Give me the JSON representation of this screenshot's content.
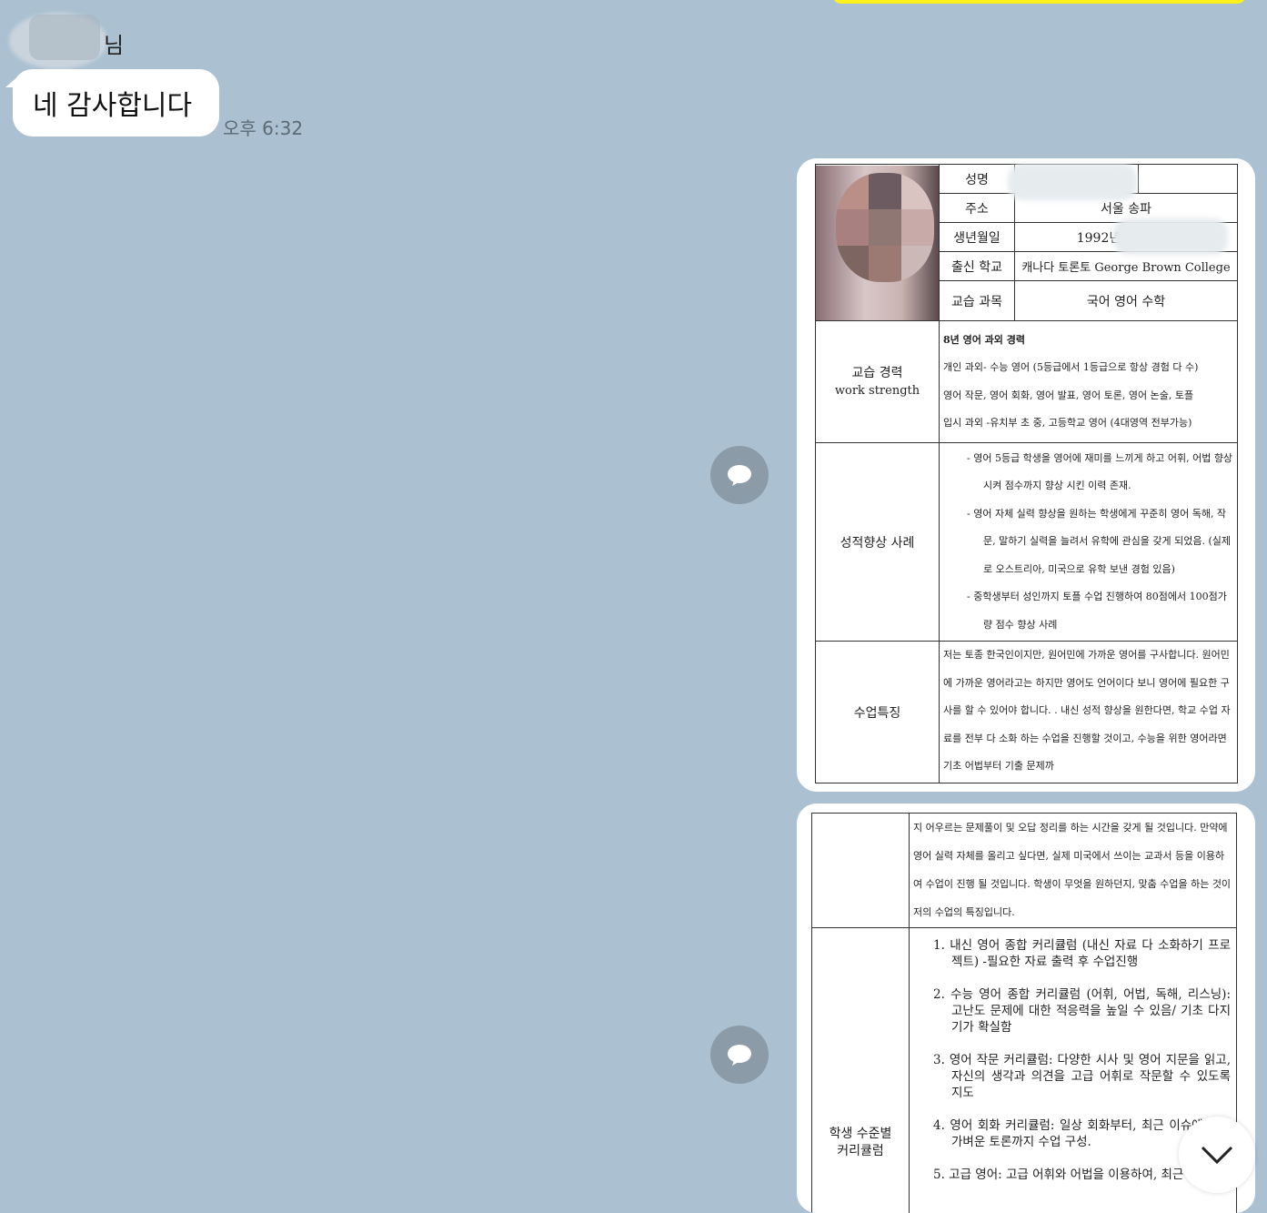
{
  "chat": {
    "sender_suffix": "님",
    "message": "네 감사합니다",
    "time": "오후 6:32"
  },
  "doc1": {
    "labels": {
      "name": "성명",
      "address": "주소",
      "birth": "생년월일",
      "school": "출신 학교",
      "subjects": "교습 과목",
      "career": "교습 경력",
      "career_en": "work strength",
      "improve": "성적향상 사례",
      "feature": "수업특징"
    },
    "values": {
      "address": "서울 송파",
      "birth": "1992년",
      "school": "캐나다 토론토 George Brown College",
      "subjects": "국어 영어 수학"
    },
    "career_lines": [
      "8년 영어 과외 경력",
      "개인 과외- 수능 영어 (5등급에서 1등급으로 항상 경험 다 수)",
      "영어 작문, 영어 회화, 영어 발표, 영어 토론, 영어 논술, 토플",
      "입시 과외 -유치부 초 중, 고등학교 영어 (4대영역 전부가능)"
    ],
    "improve_items": [
      "-   영어 5등급 학생을 영어에 재미를 느끼게 하고 어휘, 어법 향상 시켜 점수까지 향상 시킨 이력 존재.",
      "-   영어 자체 실력 향상을 원하는 학생에게 꾸준히 영어 독해, 작문, 말하기 실력을 늘려서 유학에 관심을 갖게 되었음. (실제로 오스트리아, 미국으로 유학 보낸 경험 있음)",
      "-   중학생부터 성인까지 토플 수업 진행하여 80점에서 100점가량 점수 향상 사례"
    ],
    "feature_text": "저는 토종 한국인이지만, 원어민에 가까운 영어를 구사합니다. 원어민에 가까운 영어라고는 하지만 영어도 언어이다 보니 영어에 필요한 구사를 할 수 있어야 합니다. . 내신 성적 향상을 원한다면, 학교 수업 자료를 전부 다 소화 하는 수업을 진행할 것이고, 수능을 위한 영어라면 기초 어법부터 기출 문제까"
  },
  "doc2": {
    "continued_text": "지 어우르는 문제풀이 및 오답 정리를 하는 시간을 갖게 될 것입니다. 만약에 영어 실력 자체를 올리고 싶다면, 실제 미국에서 쓰이는 교과서 등을 이용하여 수업이 진행 될 것입니다. 학생이 무엇을 원하던지, 맞춤 수업을 하는 것이 저의 수업의 특징입니다.",
    "curriculum_label": "학생 수준별 커리큘럼",
    "curriculum": [
      "1. 내신 영어 종합 커리큘럼 (내신 자료 다 소화하기 프로젝트) -필요한 자료 출력 후 수업진행",
      "2. 수능 영어 종합 커리큘럼 (어휘, 어법, 독해, 리스닝): 고난도 문제에 대한 적응력을 높일 수 있음/ 기초 다지기가 확실함",
      "3. 영어 작문 커리큘럼: 다양한 시사 및 영어 지문을 읽고, 자신의 생각과 의견을 고급 어휘로 작문할 수 있도록 지도",
      "4. 영어 회화 커리큘럼: 일상 회화부터, 최근 이슈에 대한 가벼운 토론까지 수업 구성.",
      "5. 고급 영어: 고급 어휘와 어법을 이용하여, 최근 경제"
    ]
  },
  "icons": [
    "share-icon",
    "chevron-down-icon"
  ],
  "colors": {
    "background": "#abc1d1",
    "yellow": "#fef01b",
    "share": "#8b9ba7"
  }
}
